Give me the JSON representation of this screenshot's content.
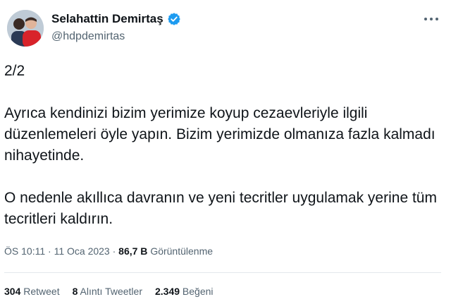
{
  "author": {
    "name": "Selahattin Demirtaş",
    "handle": "@hdpdemirtas",
    "verified_color": "#1d9bf0"
  },
  "tweet": {
    "part": "2/2",
    "paragraph1": "Ayrıca kendinizi bizim yerimize koyup cezaevleriyle ilgili düzenlemeleri öyle yapın. Bizim yerimizde olmanıza fazla kalmadı nihayetinde.",
    "paragraph2": "O nedenle akıllıca davranın ve yeni tecritler uygulamak yerine tüm tecritleri kaldırın."
  },
  "meta": {
    "time": "ÖS 10:11",
    "separator": "·",
    "date": "11 Oca 2023",
    "views_count": "86,7 B",
    "views_label": "Görüntülenme"
  },
  "stats": {
    "retweets_count": "304",
    "retweets_label": "Retweet",
    "quotes_count": "8",
    "quotes_label": "Alıntı Tweetler",
    "likes_count": "2.349",
    "likes_label": "Beğeni"
  },
  "icons": {
    "verified": "verified-badge-icon",
    "more": "more-options-icon"
  }
}
